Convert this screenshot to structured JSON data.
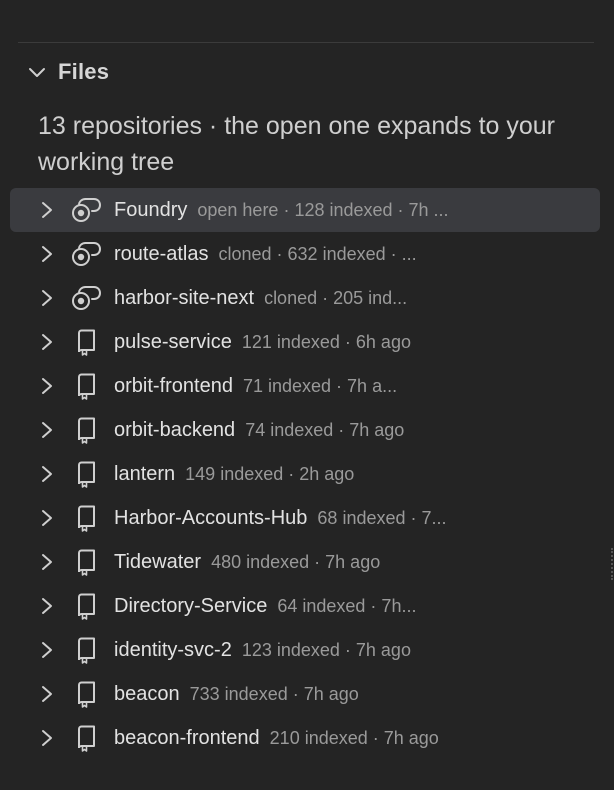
{
  "section": {
    "title": "Files",
    "summary": "13 repositories · the open one expands to your working tree"
  },
  "repos": [
    {
      "name": "Foundry",
      "meta": "open here · 128 indexed · 7h ...",
      "icon": "cloud-repo-icon",
      "active": true
    },
    {
      "name": "route-atlas",
      "meta": "cloned · 632 indexed · ...",
      "icon": "cloud-repo-icon"
    },
    {
      "name": "harbor-site-next",
      "meta": "cloned · 205 ind...",
      "icon": "cloud-repo-icon"
    },
    {
      "name": "pulse-service",
      "meta": "121 indexed · 6h ago",
      "icon": "repo-book-icon"
    },
    {
      "name": "orbit-frontend",
      "meta": "71 indexed · 7h a...",
      "icon": "repo-book-icon"
    },
    {
      "name": "orbit-backend",
      "meta": "74 indexed · 7h ago",
      "icon": "repo-book-icon"
    },
    {
      "name": "lantern",
      "meta": "149 indexed · 2h ago",
      "icon": "repo-book-icon"
    },
    {
      "name": "Harbor-Accounts-Hub",
      "meta": "68 indexed · 7...",
      "icon": "repo-book-icon"
    },
    {
      "name": "Tidewater",
      "meta": "480 indexed · 7h ago",
      "icon": "repo-book-icon"
    },
    {
      "name": "Directory-Service",
      "meta": "64 indexed · 7h...",
      "icon": "repo-book-icon"
    },
    {
      "name": "identity-svc-2",
      "meta": "123 indexed · 7h ago",
      "icon": "repo-book-icon"
    },
    {
      "name": "beacon",
      "meta": "733 indexed · 7h ago",
      "icon": "repo-book-icon"
    },
    {
      "name": "beacon-frontend",
      "meta": "210 indexed · 7h ago",
      "icon": "repo-book-icon"
    }
  ],
  "colors": {
    "background": "#242424",
    "active_row": "#3a3b3f",
    "name_text": "#e2e2e2",
    "meta_text": "#9a9a9a"
  }
}
